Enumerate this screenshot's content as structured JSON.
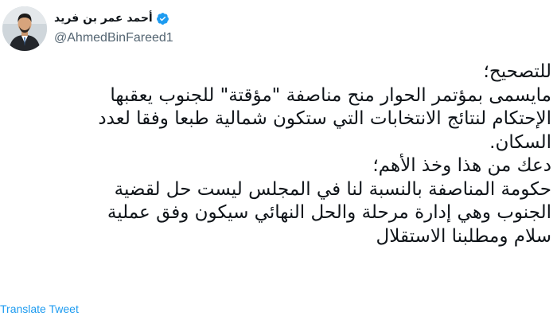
{
  "tweet": {
    "author": {
      "display_name": "أحمد عمر بن فريد",
      "handle": "@AhmedBinFareed1",
      "verified_icon": "verified-badge-icon",
      "accent_color": "#1d9bf0"
    },
    "lines": [
      "للتصحيح؛",
      "مايسمى بمؤتمر الحوار منح مناصفة \"مؤقتة\" للجنوب يعقبها",
      "الإحتكام لنتائج الانتخابات التي ستكون شمالية طبعا وفقا لعدد",
      "السكان.",
      "دعك من هذا وخذ الأهم؛",
      "حكومة المناصفة بالنسبة لنا في المجلس ليست حل لقضية",
      "الجنوب وهي إدارة مرحلة والحل النهائي سيكون وفق عملية",
      "سلام ومطلبنا الاستقلال"
    ],
    "translate_label": "Translate Tweet"
  }
}
